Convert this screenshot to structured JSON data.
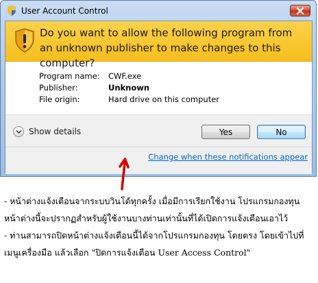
{
  "window": {
    "title": "User Account Control"
  },
  "banner": {
    "question": "Do you want to allow the following program from an unknown publisher to make changes to this computer?"
  },
  "details": [
    {
      "label": "Program name:",
      "value": "CWF.exe",
      "bold": false
    },
    {
      "label": "Publisher:",
      "value": "Unknown",
      "bold": true
    },
    {
      "label": "File origin:",
      "value": "Hard drive on this computer",
      "bold": false
    }
  ],
  "footer": {
    "show_details": "Show details",
    "yes": "Yes",
    "no": "No",
    "change_link": "Change when these notifications appear"
  },
  "notes": [
    "- หน้าต่างแจ้งเตือนจากระบบวินโด้ทุกครั้ง เมื่อมีการเรียกใช้งาน โปรแกรมกองทุน",
    "หน้าต่างนี้จะปรากฏสำหรับผู้ใช้งานบางท่านเท่านั้นที่ได้เปิดการแจ้งเตือนเอาไว้",
    "- ท่านสามารถปิดหน้าต่างแจ้งเตือนนี้ได้จากโปรแกรมกองทุน โดยตรง โดยเข้าไปที่",
    "เมนูเครื่องมือ แล้วเลือก \"ปิดการแจ้งเตือน User Access Control\""
  ],
  "colors": {
    "banner": "#f6be1c",
    "link": "#0066cc",
    "arrow": "#d40000"
  }
}
